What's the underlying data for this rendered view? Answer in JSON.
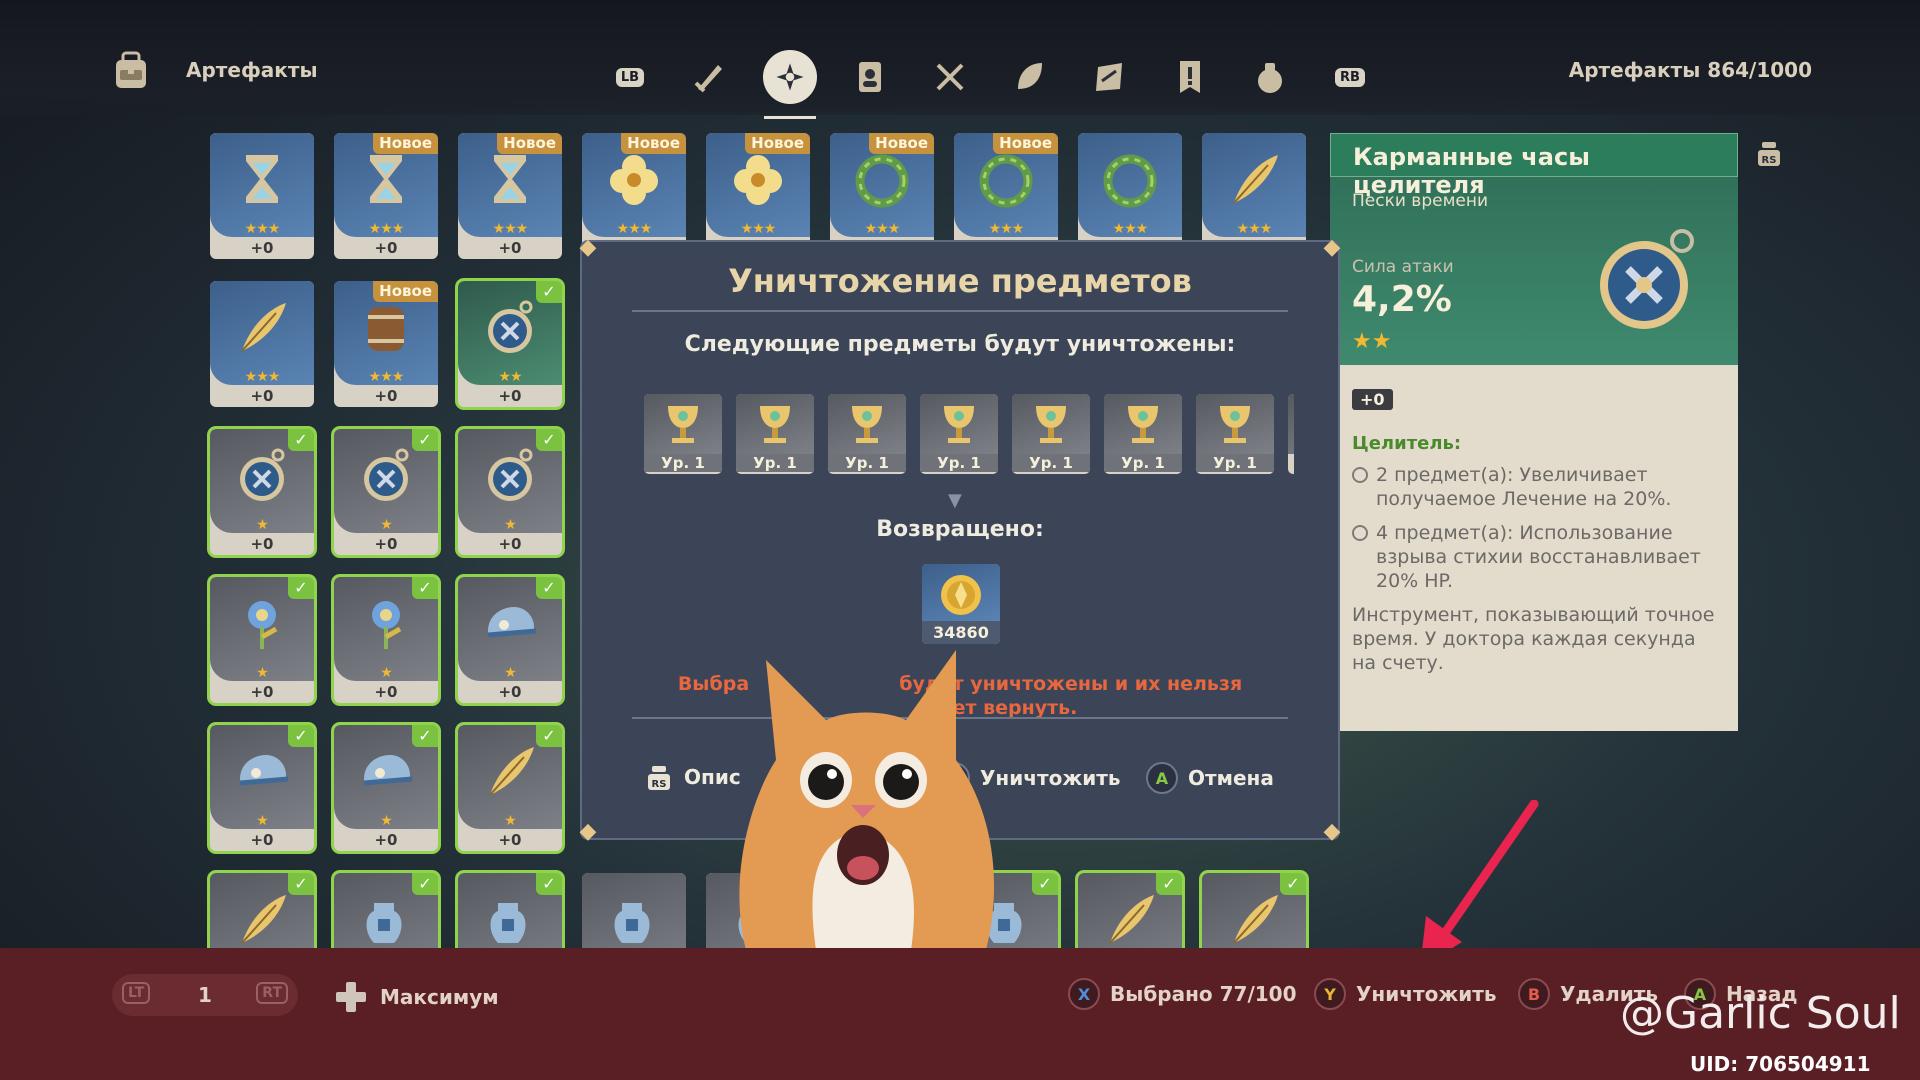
{
  "header": {
    "section_title": "Артефакты",
    "inventory_count": "Артефакты 864/1000",
    "tabs": [
      {
        "name": "LB",
        "icon": "lb-button-icon"
      },
      {
        "name": "weapons",
        "icon": "sword-icon"
      },
      {
        "name": "artifacts",
        "icon": "artifact-flower-icon",
        "active": true
      },
      {
        "name": "character-dev",
        "icon": "character-card-icon"
      },
      {
        "name": "food",
        "icon": "fork-knife-icon"
      },
      {
        "name": "materials",
        "icon": "leaf-icon"
      },
      {
        "name": "gadgets",
        "icon": "gadget-icon"
      },
      {
        "name": "quest",
        "icon": "quest-item-icon"
      },
      {
        "name": "precious",
        "icon": "money-bag-icon"
      },
      {
        "name": "RB",
        "icon": "rb-button-icon"
      }
    ],
    "lb_label": "LB",
    "rb_label": "RB"
  },
  "grid": {
    "new_label": "Новое",
    "rows": [
      [
        {
          "lvl": "+0",
          "stars": "★★★",
          "rarity": "r3",
          "icon": "hourglass-icon"
        },
        {
          "lvl": "+0",
          "stars": "★★★",
          "rarity": "r3",
          "icon": "hourglass-icon",
          "new": true
        },
        {
          "lvl": "+0",
          "stars": "★★★",
          "rarity": "r3",
          "icon": "hourglass-icon",
          "new": true
        },
        {
          "lvl": "+0",
          "stars": "★★★",
          "rarity": "r3",
          "icon": "flower-icon",
          "new": true
        },
        {
          "lvl": "+0",
          "stars": "★★★",
          "rarity": "r3",
          "icon": "flower-icon",
          "new": true
        },
        {
          "lvl": "+0",
          "stars": "★★★",
          "rarity": "r3",
          "icon": "wreath-icon",
          "new": true
        },
        {
          "lvl": "+0",
          "stars": "★★★",
          "rarity": "r3",
          "icon": "wreath-icon",
          "new": true
        },
        {
          "lvl": "+0",
          "stars": "★★★",
          "rarity": "r3",
          "icon": "wreath-icon"
        },
        {
          "lvl": "+0",
          "stars": "★★★",
          "rarity": "r3",
          "icon": "feather-icon"
        }
      ],
      [
        {
          "lvl": "+0",
          "stars": "★★★",
          "rarity": "r3",
          "icon": "feather-icon"
        },
        {
          "lvl": "+0",
          "stars": "★★★",
          "rarity": "r3",
          "icon": "barrel-icon",
          "new": true
        },
        {
          "lvl": "+0",
          "stars": "★★",
          "rarity": "r2",
          "icon": "pocket-watch-icon",
          "selected": true
        }
      ],
      [
        {
          "lvl": "+0",
          "stars": "★",
          "rarity": "r1",
          "icon": "pocket-watch-icon",
          "selected": true
        },
        {
          "lvl": "+0",
          "stars": "★",
          "rarity": "r1",
          "icon": "pocket-watch-icon",
          "selected": true
        },
        {
          "lvl": "+0",
          "stars": "★",
          "rarity": "r1",
          "icon": "pocket-watch-icon",
          "selected": true
        }
      ],
      [
        {
          "lvl": "+0",
          "stars": "★",
          "rarity": "r1",
          "icon": "blue-flower-icon",
          "selected": true
        },
        {
          "lvl": "+0",
          "stars": "★",
          "rarity": "r1",
          "icon": "blue-flower-icon",
          "selected": true
        },
        {
          "lvl": "+0",
          "stars": "★",
          "rarity": "r1",
          "icon": "cap-icon",
          "selected": true
        }
      ],
      [
        {
          "lvl": "+0",
          "stars": "★",
          "rarity": "r1",
          "icon": "cap-icon",
          "selected": true
        },
        {
          "lvl": "+0",
          "stars": "★",
          "rarity": "r1",
          "icon": "cap-icon",
          "selected": true
        },
        {
          "lvl": "+0",
          "stars": "★",
          "rarity": "r1",
          "icon": "feather-icon",
          "selected": true
        }
      ],
      [
        {
          "lvl": "",
          "stars": "",
          "rarity": "r1",
          "icon": "feather-icon",
          "selected": true
        },
        {
          "lvl": "",
          "stars": "",
          "rarity": "r1",
          "icon": "jug-icon",
          "selected": true
        },
        {
          "lvl": "",
          "stars": "",
          "rarity": "r1",
          "icon": "jug-icon",
          "selected": true
        },
        {
          "lvl": "",
          "stars": "",
          "rarity": "r1",
          "icon": "jug-icon"
        },
        {
          "lvl": "",
          "stars": "",
          "rarity": "r1",
          "icon": "jug-icon"
        },
        {
          "lvl": "",
          "stars": "",
          "rarity": "r1",
          "icon": "jug-icon"
        },
        {
          "lvl": "",
          "stars": "",
          "rarity": "r1",
          "icon": "jug-icon",
          "selected": true
        },
        {
          "lvl": "",
          "stars": "",
          "rarity": "r1",
          "icon": "feather-icon",
          "selected": true
        },
        {
          "lvl": "",
          "stars": "",
          "rarity": "r1",
          "icon": "feather-icon",
          "selected": true
        }
      ]
    ]
  },
  "detail": {
    "title": "Карманные часы целителя",
    "slot": "Пески времени",
    "stat_name": "Сила атаки",
    "stat_value": "4,2%",
    "stars": "★★",
    "level": "+0",
    "set_name": "Целитель:",
    "bonus_2": "2 предмет(а): Увеличивает получаемое Лечение на 20%.",
    "bonus_4": "4 предмет(а): Использование взрыва стихии восстанавливает 20% HP.",
    "description": "Инструмент, показывающий точное время. У доктора каждая секунда на счету.",
    "rs_label": "RS"
  },
  "modal": {
    "title": "Уничтожение предметов",
    "subtitle": "Следующие предметы будут уничтожены:",
    "items": [
      "Ур. 1",
      "Ур. 1",
      "Ур. 1",
      "Ур. 1",
      "Ур. 1",
      "Ур. 1",
      "Ур. 1"
    ],
    "returned_label": "Возвращено:",
    "returned_amount": "34860",
    "warning_visible_left": "Выбра",
    "warning_visible_right": "будут уничтожены и их нельзя",
    "warning_line2": "ет вернуть.",
    "action_desc": "Опис",
    "action_destroy": "Уничтожить",
    "action_cancel": "Отмена",
    "btn_b": "B",
    "btn_a": "A",
    "rs_label": "RS"
  },
  "bottom": {
    "lt": "LT",
    "rt": "RT",
    "quantity": "1",
    "max_label": "Максимум",
    "selected": "Выбрано 77/100",
    "destroy": "Уничтожить",
    "delete": "Удалить",
    "back": "Назад",
    "btn_x": "X",
    "btn_y": "Y",
    "btn_b": "B",
    "btn_a": "A"
  },
  "overlay": {
    "watermark": "@Garlic Soul",
    "uid": "UID: 706504911"
  },
  "colors": {
    "accent_green": "#2b7d5c",
    "warning": "#e8673f",
    "bottom_bar": "#5a1f25",
    "selected_check": "#7ac23f",
    "new_badge": "#c6923e",
    "arrow": "#e8244f"
  }
}
